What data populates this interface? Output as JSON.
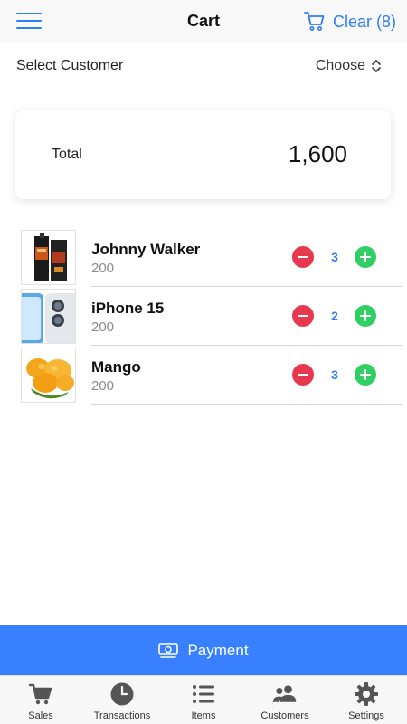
{
  "header": {
    "title": "Cart",
    "clear_label": "Clear (8)"
  },
  "customer": {
    "label": "Select Customer",
    "choose_label": "Choose"
  },
  "total": {
    "label": "Total",
    "value": "1,600"
  },
  "cart_items": [
    {
      "name": "Johnny Walker",
      "price": "200",
      "quantity": "3"
    },
    {
      "name": "iPhone 15",
      "price": "200",
      "quantity": "2"
    },
    {
      "name": "Mango",
      "price": "200",
      "quantity": "3"
    }
  ],
  "payment": {
    "label": "Payment"
  },
  "tabs": [
    {
      "label": "Sales",
      "icon": "cart-icon"
    },
    {
      "label": "Transactions",
      "icon": "clock-icon"
    },
    {
      "label": "Items",
      "icon": "list-icon"
    },
    {
      "label": "Customers",
      "icon": "people-icon"
    },
    {
      "label": "Settings",
      "icon": "gear-icon"
    }
  ],
  "colors": {
    "accent": "#3880ff",
    "minus": "#e8384f",
    "plus": "#2fcf64",
    "tab_icon": "#555555"
  }
}
